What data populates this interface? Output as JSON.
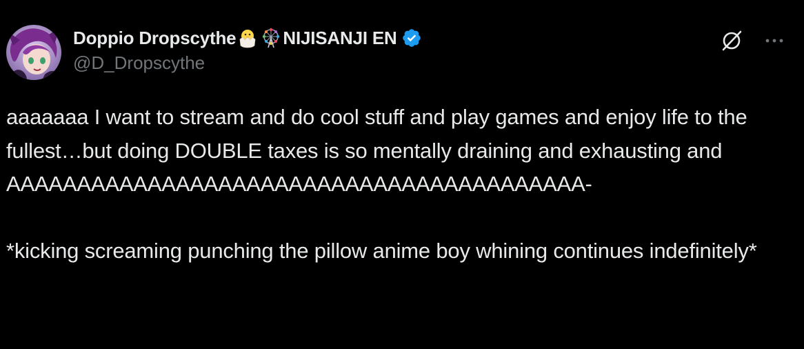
{
  "tweet": {
    "display_name": "Doppio Dropscythe",
    "name_suffix": "NIJISANJI EN",
    "handle": "@D_Dropscythe",
    "verified": true,
    "text": "aaaaaaa I want to stream and do cool stuff and play games and enjoy life to the fullest…but doing DOUBLE taxes is so mentally draining and exhausting and\nAAAAAAAAAAAAAAAAAAAAAAAAAAAAAAAAAAAAAAAAA-\n\n*kicking screaming punching the pillow anime boy whining continues indefinitely*"
  },
  "icons": {
    "avatar": "avatar",
    "hatching_chick": "hatching-chick-emoji",
    "ferris_wheel": "ferris-wheel-emoji",
    "verified_badge": "verified-badge-icon",
    "grok": "grok-icon",
    "more": "more-icon"
  },
  "colors": {
    "background": "#000000",
    "text_primary": "#e7e9ea",
    "text_secondary": "#71767b",
    "verified_blue": "#1d9bf0"
  }
}
